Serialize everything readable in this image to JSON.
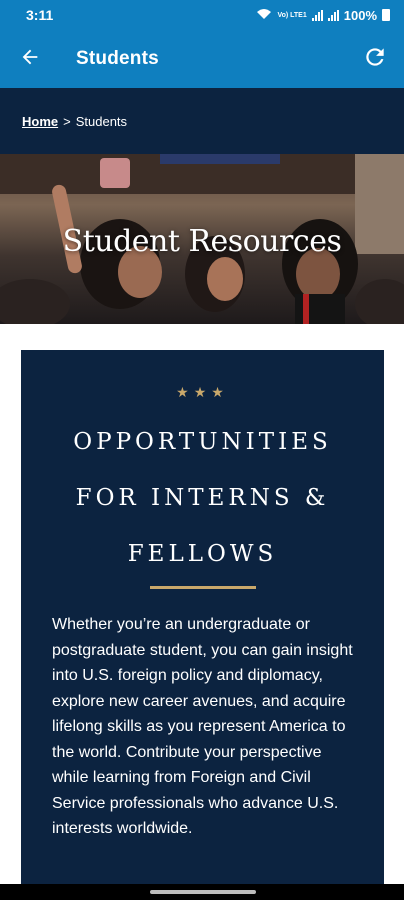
{
  "status_bar": {
    "time": "3:11",
    "volte_label": "Vo) LTE1",
    "battery": "100%"
  },
  "app_bar": {
    "title": "Students",
    "back_icon": "arrow-back-icon",
    "refresh_icon": "refresh-icon"
  },
  "breadcrumb": {
    "home": "Home",
    "separator": ">",
    "current": "Students"
  },
  "hero": {
    "title": "Student Resources"
  },
  "card": {
    "stars": "★★★",
    "heading_lines": [
      "OPPORTUNITIES",
      "FOR INTERNS &",
      "FELLOWS"
    ],
    "body": "Whether you’re an undergraduate or postgraduate student, you can gain insight into U.S. foreign policy and diplomacy, explore new career avenues, and acquire lifelong skills as you represent America to the world. Contribute your perspective while learning from Foreign and Civil Service professionals who advance U.S. interests worldwide."
  },
  "colors": {
    "app_bar": "#0f7fbf",
    "navy": "#0c2340",
    "gold": "#c9a86b"
  }
}
